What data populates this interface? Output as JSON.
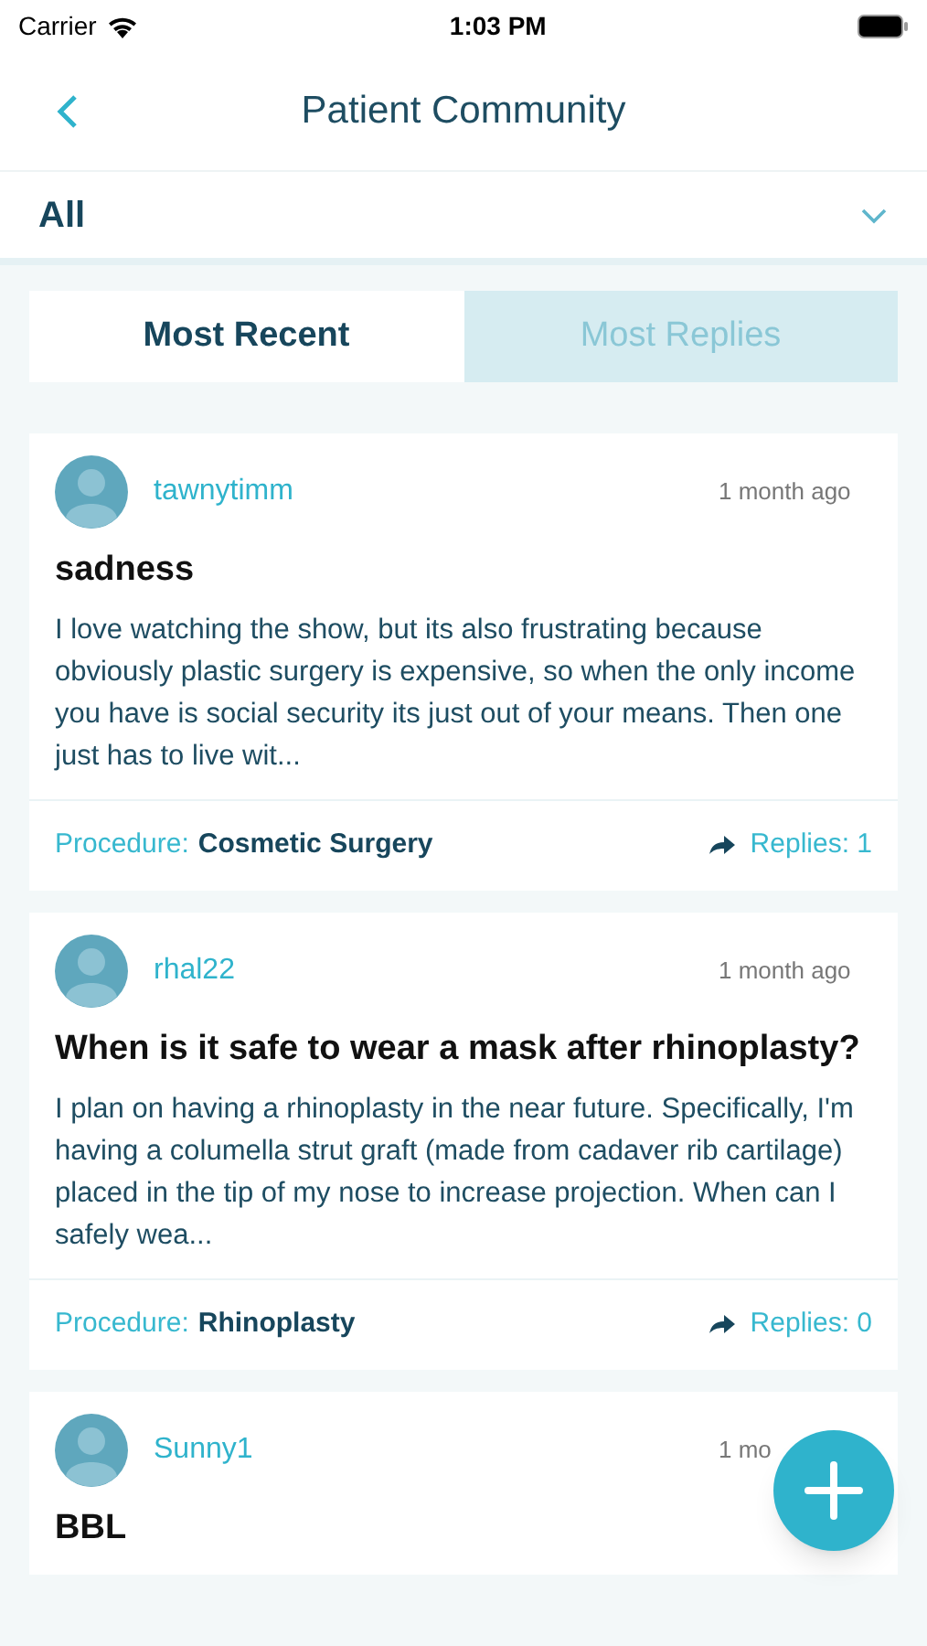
{
  "status_bar": {
    "carrier": "Carrier",
    "time": "1:03 PM"
  },
  "header": {
    "title": "Patient Community"
  },
  "filter": {
    "value": "All"
  },
  "tabs": [
    {
      "label": "Most Recent",
      "selected": true
    },
    {
      "label": "Most Replies",
      "selected": false
    }
  ],
  "posts": [
    {
      "username": "tawnytimm",
      "time": "1 month ago",
      "title": "sadness",
      "body": "I love watching the show,  but its also frustrating because obviously plastic surgery is expensive, so when the only income you have is social security its just out of your means. Then one just has to live wit...",
      "procedure_label": "Procedure:",
      "procedure": "Cosmetic Surgery",
      "replies": "Replies: 1"
    },
    {
      "username": "rhal22",
      "time": "1 month ago",
      "title": "When is it safe to wear a mask after rhinoplasty?",
      "body": "I plan on having a rhinoplasty in the near future. Specifically, I'm having a columella strut graft (made from cadaver rib cartilage) placed in the tip of my nose to increase projection. When can I safely wea...",
      "procedure_label": "Procedure:",
      "procedure": "Rhinoplasty",
      "replies": "Replies: 0"
    },
    {
      "username": "Sunny1",
      "time": "1 mo",
      "title": "BBL"
    }
  ]
}
